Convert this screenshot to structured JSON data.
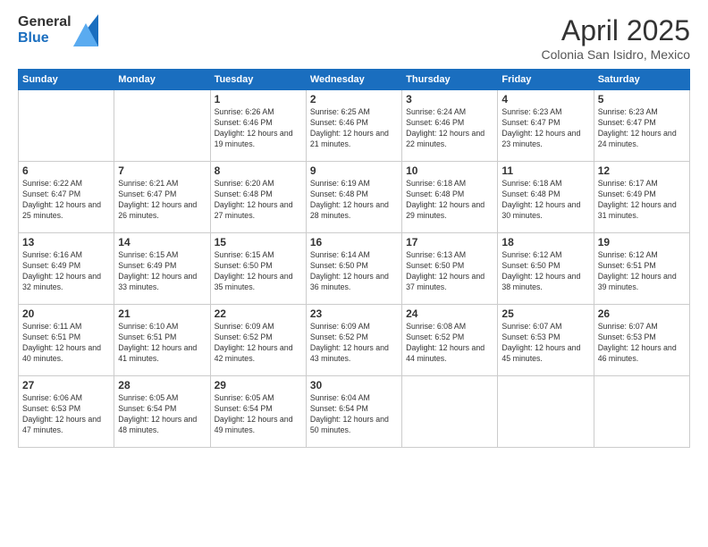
{
  "header": {
    "logo_general": "General",
    "logo_blue": "Blue",
    "title": "April 2025",
    "location": "Colonia San Isidro, Mexico"
  },
  "days_of_week": [
    "Sunday",
    "Monday",
    "Tuesday",
    "Wednesday",
    "Thursday",
    "Friday",
    "Saturday"
  ],
  "weeks": [
    [
      {
        "day": "",
        "info": ""
      },
      {
        "day": "",
        "info": ""
      },
      {
        "day": "1",
        "sunrise": "6:26 AM",
        "sunset": "6:46 PM",
        "daylight": "12 hours and 19 minutes."
      },
      {
        "day": "2",
        "sunrise": "6:25 AM",
        "sunset": "6:46 PM",
        "daylight": "12 hours and 21 minutes."
      },
      {
        "day": "3",
        "sunrise": "6:24 AM",
        "sunset": "6:46 PM",
        "daylight": "12 hours and 22 minutes."
      },
      {
        "day": "4",
        "sunrise": "6:23 AM",
        "sunset": "6:47 PM",
        "daylight": "12 hours and 23 minutes."
      },
      {
        "day": "5",
        "sunrise": "6:23 AM",
        "sunset": "6:47 PM",
        "daylight": "12 hours and 24 minutes."
      }
    ],
    [
      {
        "day": "6",
        "sunrise": "6:22 AM",
        "sunset": "6:47 PM",
        "daylight": "12 hours and 25 minutes."
      },
      {
        "day": "7",
        "sunrise": "6:21 AM",
        "sunset": "6:47 PM",
        "daylight": "12 hours and 26 minutes."
      },
      {
        "day": "8",
        "sunrise": "6:20 AM",
        "sunset": "6:48 PM",
        "daylight": "12 hours and 27 minutes."
      },
      {
        "day": "9",
        "sunrise": "6:19 AM",
        "sunset": "6:48 PM",
        "daylight": "12 hours and 28 minutes."
      },
      {
        "day": "10",
        "sunrise": "6:18 AM",
        "sunset": "6:48 PM",
        "daylight": "12 hours and 29 minutes."
      },
      {
        "day": "11",
        "sunrise": "6:18 AM",
        "sunset": "6:48 PM",
        "daylight": "12 hours and 30 minutes."
      },
      {
        "day": "12",
        "sunrise": "6:17 AM",
        "sunset": "6:49 PM",
        "daylight": "12 hours and 31 minutes."
      }
    ],
    [
      {
        "day": "13",
        "sunrise": "6:16 AM",
        "sunset": "6:49 PM",
        "daylight": "12 hours and 32 minutes."
      },
      {
        "day": "14",
        "sunrise": "6:15 AM",
        "sunset": "6:49 PM",
        "daylight": "12 hours and 33 minutes."
      },
      {
        "day": "15",
        "sunrise": "6:15 AM",
        "sunset": "6:50 PM",
        "daylight": "12 hours and 35 minutes."
      },
      {
        "day": "16",
        "sunrise": "6:14 AM",
        "sunset": "6:50 PM",
        "daylight": "12 hours and 36 minutes."
      },
      {
        "day": "17",
        "sunrise": "6:13 AM",
        "sunset": "6:50 PM",
        "daylight": "12 hours and 37 minutes."
      },
      {
        "day": "18",
        "sunrise": "6:12 AM",
        "sunset": "6:50 PM",
        "daylight": "12 hours and 38 minutes."
      },
      {
        "day": "19",
        "sunrise": "6:12 AM",
        "sunset": "6:51 PM",
        "daylight": "12 hours and 39 minutes."
      }
    ],
    [
      {
        "day": "20",
        "sunrise": "6:11 AM",
        "sunset": "6:51 PM",
        "daylight": "12 hours and 40 minutes."
      },
      {
        "day": "21",
        "sunrise": "6:10 AM",
        "sunset": "6:51 PM",
        "daylight": "12 hours and 41 minutes."
      },
      {
        "day": "22",
        "sunrise": "6:09 AM",
        "sunset": "6:52 PM",
        "daylight": "12 hours and 42 minutes."
      },
      {
        "day": "23",
        "sunrise": "6:09 AM",
        "sunset": "6:52 PM",
        "daylight": "12 hours and 43 minutes."
      },
      {
        "day": "24",
        "sunrise": "6:08 AM",
        "sunset": "6:52 PM",
        "daylight": "12 hours and 44 minutes."
      },
      {
        "day": "25",
        "sunrise": "6:07 AM",
        "sunset": "6:53 PM",
        "daylight": "12 hours and 45 minutes."
      },
      {
        "day": "26",
        "sunrise": "6:07 AM",
        "sunset": "6:53 PM",
        "daylight": "12 hours and 46 minutes."
      }
    ],
    [
      {
        "day": "27",
        "sunrise": "6:06 AM",
        "sunset": "6:53 PM",
        "daylight": "12 hours and 47 minutes."
      },
      {
        "day": "28",
        "sunrise": "6:05 AM",
        "sunset": "6:54 PM",
        "daylight": "12 hours and 48 minutes."
      },
      {
        "day": "29",
        "sunrise": "6:05 AM",
        "sunset": "6:54 PM",
        "daylight": "12 hours and 49 minutes."
      },
      {
        "day": "30",
        "sunrise": "6:04 AM",
        "sunset": "6:54 PM",
        "daylight": "12 hours and 50 minutes."
      },
      {
        "day": "",
        "info": ""
      },
      {
        "day": "",
        "info": ""
      },
      {
        "day": "",
        "info": ""
      }
    ]
  ],
  "labels": {
    "sunrise_label": "Sunrise:",
    "sunset_label": "Sunset:",
    "daylight_label": "Daylight: "
  }
}
